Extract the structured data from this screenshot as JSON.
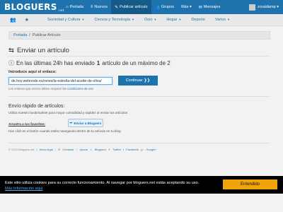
{
  "topnav": {
    "logo": "BLOGUERS",
    "logo_suffix": ".net",
    "items": [
      {
        "icon": "home-icon",
        "glyph": "⌂",
        "label": "Portada"
      },
      {
        "icon": "list-icon",
        "glyph": "≡",
        "label": "Nuevos"
      },
      {
        "icon": "pencil-icon",
        "glyph": "✎",
        "label": "Publicar artículo"
      },
      {
        "icon": "users-icon",
        "glyph": "👥",
        "label": "Grupos"
      },
      {
        "icon": "more-icon",
        "glyph": "",
        "label": "Más ▾"
      },
      {
        "icon": "mail-icon",
        "glyph": "✉",
        "label": "Mensajes"
      }
    ],
    "user": "zoraidamp ▾"
  },
  "subnav": {
    "items": [
      "Sociedad y Cultura",
      "Ciencia y Tecnología",
      "Ocio",
      "Hogar",
      "Deporte",
      "Varios"
    ]
  },
  "breadcrumb": {
    "home": "Portada",
    "separator": "/",
    "current": "Publicar Artículo"
  },
  "main": {
    "title": "Enviar un artículo",
    "limit_prefix": "En las últimas 24h has enviado",
    "limit_count": "1",
    "limit_suffix": "artículo de un máximo de 2",
    "link_label": "Introduce aquí el enlace:",
    "link_value": "de.hoy.webnode.es/news/la-estrella-del-aceite-de-oliva/",
    "continue_button": "Continuar ❯❯",
    "note_prefix": "Los enlaces que envíes deben respetar las",
    "note_link": "condiciones de uso"
  },
  "quick": {
    "title": "Envío rápido de artículos:",
    "description": "Utiliza nuestro bookmarklet para mayor comodidad y rapidez al enviar tus artículos",
    "drag_label": "Arrastra a tus favoritos:",
    "bookmarklet_label": "Enviar a Bloguers",
    "hint": "Haz click en el botón cuando estés navegando dentro de tu artículo en tu blog"
  },
  "footer": {
    "copyright": "© 2015 Bloguers.net",
    "links": [
      "Aviso legal",
      "Contacto",
      "Ayuda",
      "Bloguero",
      "Twitter",
      "Facebook",
      "Google+"
    ]
  },
  "cookie": {
    "text": "Este sitio utiliza cookies para su correcto funcionamiento. Al navegar por bloguers.net estás aceptando su uso.",
    "link": "Más información aquí",
    "button": "Entendido"
  }
}
